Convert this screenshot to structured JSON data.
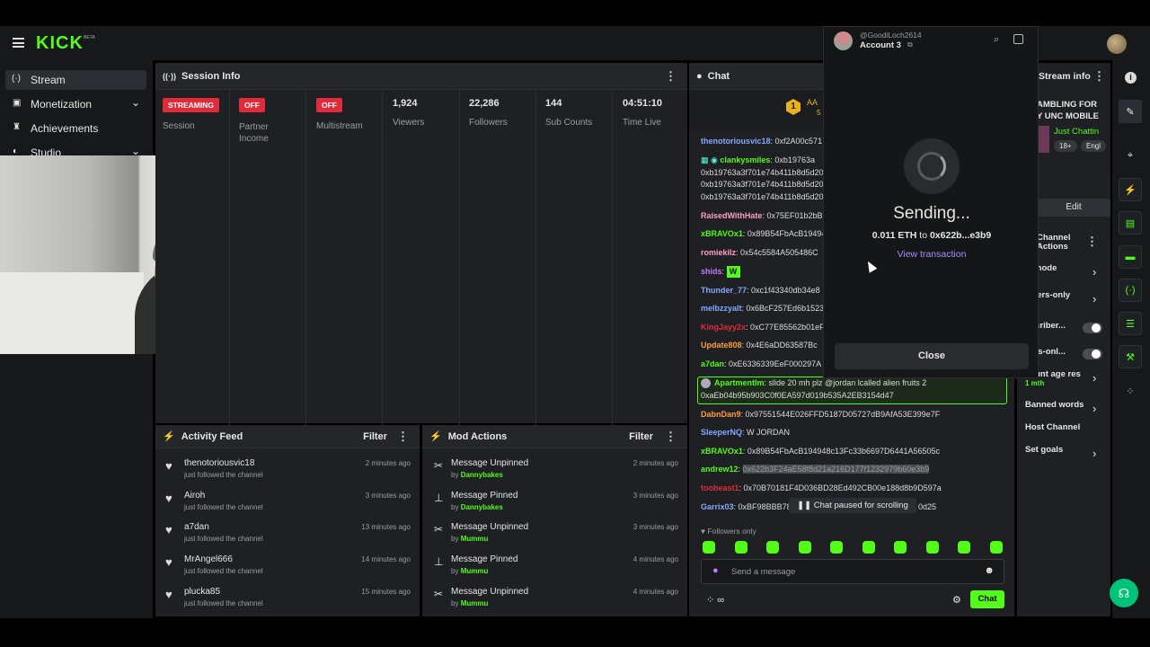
{
  "brand": {
    "logo": "KICK",
    "beta": "BETA"
  },
  "sidebar": {
    "items": [
      {
        "label": "Stream"
      },
      {
        "label": "Monetization"
      },
      {
        "label": "Achievements"
      },
      {
        "label": "Studio"
      }
    ]
  },
  "session": {
    "title": "Session Info",
    "stats": [
      {
        "badge": "STREAMING",
        "label": "Session"
      },
      {
        "badge": "OFF",
        "label": "Partner Income"
      },
      {
        "badge": "OFF",
        "label": "Multistream"
      },
      {
        "value": "1,924",
        "label": "Viewers"
      },
      {
        "value": "22,286",
        "label": "Followers"
      },
      {
        "value": "144",
        "label": "Sub Counts"
      },
      {
        "value": "04:51:10",
        "label": "Time Live"
      }
    ]
  },
  "activity": {
    "title": "Activity Feed",
    "filter": "Filter",
    "rows": [
      {
        "user": "thenotoriousvic18",
        "desc": "just followed the channel",
        "time": "2 minutes ago"
      },
      {
        "user": "Airoh",
        "desc": "just followed the channel",
        "time": "3 minutes ago"
      },
      {
        "user": "a7dan",
        "desc": "just followed the channel",
        "time": "13 minutes ago"
      },
      {
        "user": "MrAngel666",
        "desc": "just followed the channel",
        "time": "14 minutes ago"
      },
      {
        "user": "plucka85",
        "desc": "just followed the channel",
        "time": "15 minutes ago"
      }
    ]
  },
  "mod": {
    "title": "Mod Actions",
    "filter": "Filter",
    "rows": [
      {
        "action": "Message Unpinned",
        "by": "by",
        "user": "Dannybakes",
        "time": "2 minutes ago"
      },
      {
        "action": "Message Pinned",
        "by": "by",
        "user": "Dannybakes",
        "time": "3 minutes ago"
      },
      {
        "action": "Message Unpinned",
        "by": "by",
        "user": "Mummu",
        "time": "3 minutes ago"
      },
      {
        "action": "Message Pinned",
        "by": "by",
        "user": "Mummu",
        "time": "4 minutes ago"
      },
      {
        "action": "Message Unpinned",
        "by": "by",
        "user": "Mummu",
        "time": "4 minutes ago"
      }
    ]
  },
  "chat": {
    "title": "Chat",
    "pinned_badge": "AA",
    "pinned_sub": "5",
    "lines": [
      {
        "user": "thenotoriousvic18",
        "text": "0xf2A00c571",
        "color": "#86a8ff"
      },
      {
        "user": "clankysmiles",
        "text": "0xb19763a",
        "color": "#53fc18"
      },
      {
        "user": "",
        "text": "0xb19763a3f701e74b411b8d5d20",
        "color": "#dcdcdc"
      },
      {
        "user": "",
        "text": "0xb19763a3f701e74b411b8d5d20",
        "color": "#dcdcdc"
      },
      {
        "user": "",
        "text": "0xb19763a3f701e74b411b8d5d20",
        "color": "#dcdcdc"
      },
      {
        "user": "RaisedWithHate",
        "text": "0x75EF01b2bB",
        "color": "#ff9ec8"
      },
      {
        "user": "xBRAVOx1",
        "text": "0x89B54FbAcB19494",
        "color": "#53fc18"
      },
      {
        "user": "romiekilz",
        "text": "0x54c5584A505486C",
        "color": "#ff9ec8"
      },
      {
        "user": "shids",
        "text": "",
        "color": "#c27bff"
      },
      {
        "user": "Thunder_77",
        "text": "0xc1f43340db34e8",
        "color": "#86a8ff"
      },
      {
        "user": "melbzzyalt",
        "text": "0x6BcF257Ed6b1523",
        "color": "#86a8ff"
      },
      {
        "user": "KingJayy2x",
        "text": "0xC77E85562b01eF",
        "color": "#e22b3a"
      },
      {
        "user": "Update808",
        "text": "0x4E6aDD63587Bc",
        "color": "#ff9d3a"
      },
      {
        "user": "a7dan",
        "text": "0xE6336339EeF000297A",
        "color": "#53fc18"
      }
    ],
    "highlight": {
      "user": "ApartmentIm",
      "text": "slide 20 mh plz @jordan lcalled alien fruits 2",
      "line2": "0xaEb04b95b903C0f0EA597d019b535A2EB3154d47"
    },
    "lines2": [
      {
        "user": "DabnDan9",
        "text": "0x97551544E026FFD5187D05727dB9AfA53E399e7F",
        "color": "#ff9d3a"
      },
      {
        "user": "SleeperNQ",
        "text": "W JORDAN",
        "color": "#86a8ff"
      },
      {
        "user": "xBRAVOx1",
        "text": "0x89B54FbAcB194948c13Fc33b6697D6441A56505c",
        "color": "#53fc18"
      },
      {
        "user": "andrew12",
        "text": "0x622b3F24aE58f8d21a216D177f1232979b60e3b9",
        "color": "#53fc18"
      },
      {
        "user": "toobeast1",
        "text": "0x70B70181F4D036BD28Ed492CB00e188d8b9D597a",
        "color": "#e22b3a"
      },
      {
        "user": "Garrix03",
        "text": "0xBF98BBB78",
        "color": "#86a8ff",
        "tail": "0d25"
      }
    ],
    "paused": "Chat paused for scrolling",
    "followers_only": "Followers only",
    "placeholder": "Send a message",
    "send": "Chat"
  },
  "wallet": {
    "handle": "@GoodiLoch2614",
    "account": "Account 3",
    "status": "Sending...",
    "amount": "0.011 ETH",
    "to": "to",
    "address": "0x622b...e3b9",
    "view": "View transaction",
    "close": "Close"
  },
  "streaminfo": {
    "title": "Stream info",
    "line1": "AMBLING FOR",
    "line2": "Y UNC MOBILE",
    "category": "Just Chattin",
    "tag1": "18+",
    "tag2": "Engl",
    "edit": "Edit"
  },
  "channel_actions": {
    "title": "Channel Actions",
    "items": [
      {
        "label": "w mode",
        "type": "chevron"
      },
      {
        "label": "owers-only",
        "type": "chevron"
      },
      {
        "label": "oscriber...",
        "type": "toggle"
      },
      {
        "label": "otes-onl...",
        "type": "toggle"
      },
      {
        "label": "count age res",
        "type": "chevron",
        "sub": "1 mth"
      },
      {
        "label": "Banned words",
        "type": "chevron"
      },
      {
        "label": "Host Channel",
        "type": "none"
      },
      {
        "label": "Set goals",
        "type": "chevron"
      }
    ]
  },
  "colors": {
    "accent": "#53fc18",
    "live": "#e22b3a",
    "panel": "#1e2023",
    "bg": "#000000"
  }
}
